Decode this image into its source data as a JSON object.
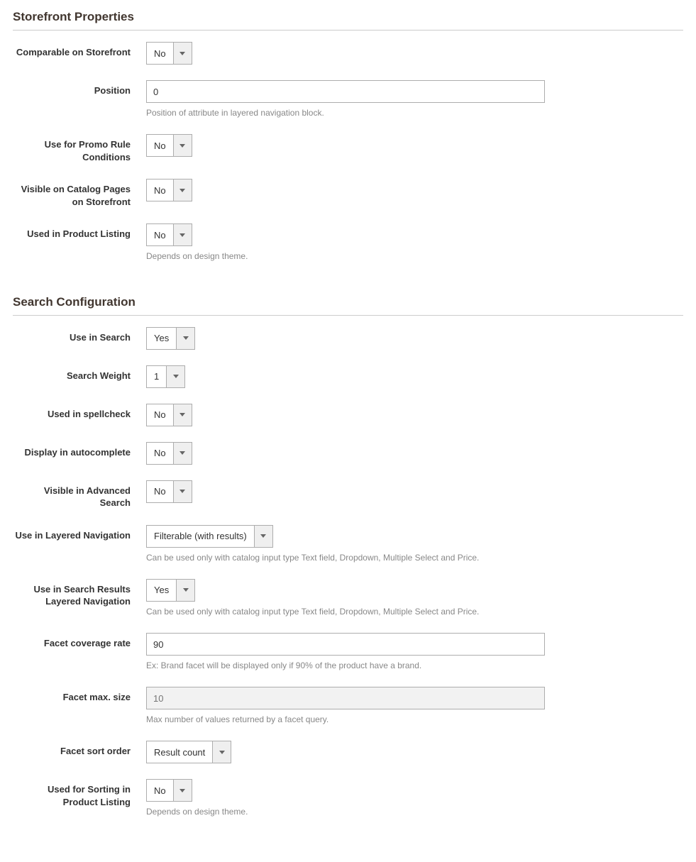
{
  "sections": {
    "storefront": {
      "title": "Storefront Properties",
      "comparable_label": "Comparable on Storefront",
      "comparable_value": "No",
      "position_label": "Position",
      "position_value": "0",
      "position_note": "Position of attribute in layered navigation block.",
      "promo_label": "Use for Promo Rule Conditions",
      "promo_value": "No",
      "visible_catalog_label": "Visible on Catalog Pages on Storefront",
      "visible_catalog_value": "No",
      "product_listing_label": "Used in Product Listing",
      "product_listing_value": "No",
      "product_listing_note": "Depends on design theme."
    },
    "search": {
      "title": "Search Configuration",
      "use_in_search_label": "Use in Search",
      "use_in_search_value": "Yes",
      "search_weight_label": "Search Weight",
      "search_weight_value": "1",
      "spellcheck_label": "Used in spellcheck",
      "spellcheck_value": "No",
      "autocomplete_label": "Display in autocomplete",
      "autocomplete_value": "No",
      "advanced_search_label": "Visible in Advanced Search",
      "advanced_search_value": "No",
      "layered_nav_label": "Use in Layered Navigation",
      "layered_nav_value": "Filterable (with results)",
      "layered_nav_note": "Can be used only with catalog input type Text field, Dropdown, Multiple Select and Price.",
      "search_results_nav_label": "Use in Search Results Layered Navigation",
      "search_results_nav_value": "Yes",
      "search_results_nav_note": "Can be used only with catalog input type Text field, Dropdown, Multiple Select and Price.",
      "facet_coverage_label": "Facet coverage rate",
      "facet_coverage_value": "90",
      "facet_coverage_note": "Ex: Brand facet will be displayed only if 90% of the product have a brand.",
      "facet_max_label": "Facet max. size",
      "facet_max_placeholder": "10",
      "facet_max_note": "Max number of values returned by a facet query.",
      "facet_sort_label": "Facet sort order",
      "facet_sort_value": "Result count",
      "sorting_listing_label": "Used for Sorting in Product Listing",
      "sorting_listing_value": "No",
      "sorting_listing_note": "Depends on design theme."
    }
  }
}
